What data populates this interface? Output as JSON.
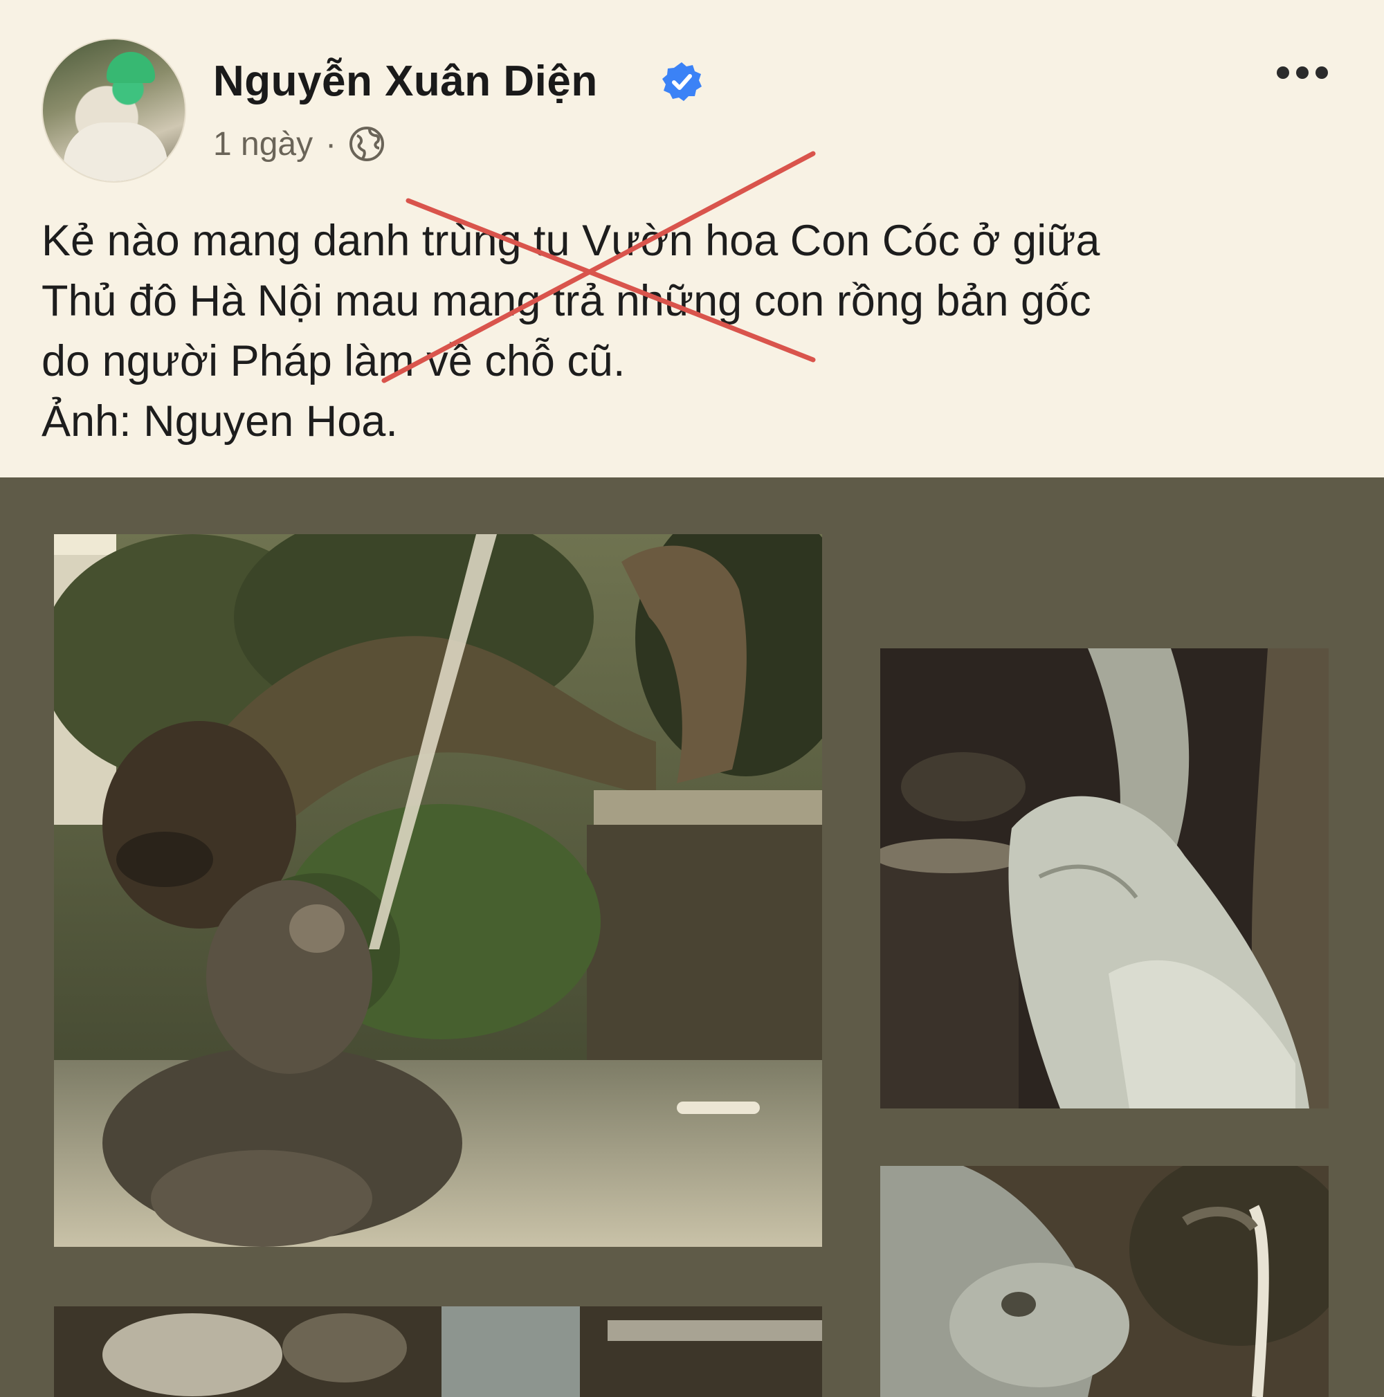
{
  "post": {
    "author_name": "Nguyễn Xuân Diện",
    "timestamp": "1 ngày",
    "separator": "·",
    "verified_icon": "verified-badge-icon",
    "privacy_icon": "globe-icon",
    "more_icon": "more-options-icon",
    "text_lines": [
      "Kẻ nào mang danh trùng tu Vườn hoa Con Cóc ở giữa",
      "Thủ đô Hà Nội mau mang trả những con rồng bản gốc",
      "do người Pháp làm về chỗ cũ.",
      "Ảnh: Nguyen Hoa."
    ],
    "overlay_mark_color": "#d9544c",
    "verified_color": "#3b82f6"
  },
  "gallery": {
    "photos": [
      {
        "name": "photo-toad-fountain"
      },
      {
        "name": "photo-dragon-statue-closeup"
      },
      {
        "name": "photo-dragon-head"
      },
      {
        "name": "photo-fountain-bottom"
      }
    ]
  }
}
